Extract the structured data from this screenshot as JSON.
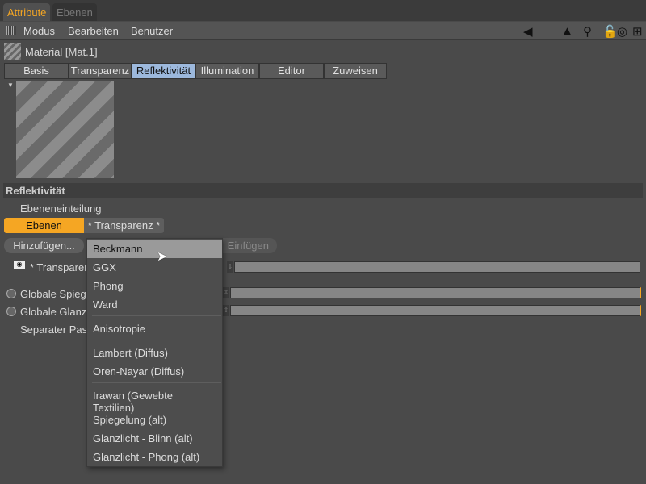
{
  "panel_tabs": [
    "Attribute",
    "Ebenen"
  ],
  "menu": [
    "Modus",
    "Bearbeiten",
    "Benutzer"
  ],
  "material_title": "Material [Mat.1]",
  "tabs": [
    "Basis",
    "Transparenz",
    "Reflektivität",
    "Illumination",
    "Editor",
    "Zuweisen"
  ],
  "active_tab": "Reflektivität",
  "section": {
    "title": "Reflektivität",
    "layer_label": "Ebeneneinteilung",
    "layer_buttons": [
      "Ebenen",
      "* Transparenz *"
    ],
    "add_button": "Hinzufügen...",
    "paste_button": "Einfügen"
  },
  "rows": {
    "layer": "* Transparenz",
    "global_spec": "Globale Spiegelung",
    "global_gloss": "Globale Glanzlicht",
    "separate": "Separater Pass"
  },
  "slider_values": {
    "layer": 0,
    "global_spec": 100,
    "global_gloss": 100
  },
  "dropdown": {
    "items": [
      "Beckmann",
      "GGX",
      "Phong",
      "Ward",
      "Anisotropie",
      "Lambert (Diffus)",
      "Oren-Nayar (Diffus)",
      "Irawan (Gewebte Textilien)",
      "Spiegelung (alt)",
      "Glanzlicht - Blinn (alt)",
      "Glanzlicht - Phong (alt)"
    ],
    "highlighted": "Beckmann"
  },
  "colors": {
    "accent": "#f5a623",
    "active_tab": "#9cb8dc"
  }
}
